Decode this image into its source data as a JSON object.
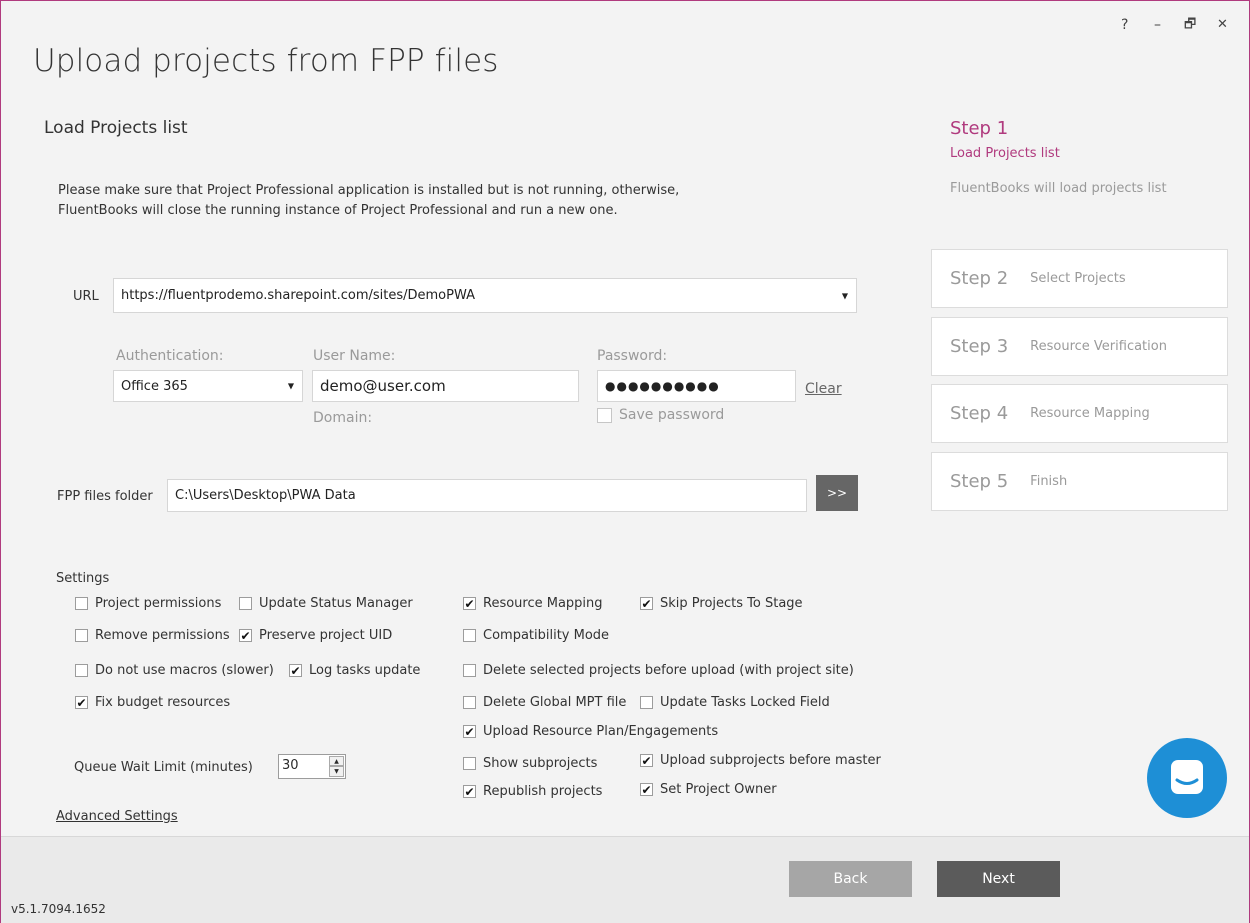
{
  "window": {
    "controls": {
      "help": "?",
      "minimize": "–",
      "restore": "🗗",
      "close": "✕"
    }
  },
  "header": {
    "title": "Upload projects from FPP files"
  },
  "section": {
    "title": "Load Projects list",
    "note_line1": "Please make sure that Project Professional application is installed but is not running, otherwise,",
    "note_line2": "FluentBooks will close the running instance of Project Professional and run a new one."
  },
  "connection": {
    "url_label": "URL",
    "url_value": "https://fluentprodemo.sharepoint.com/sites/DemoPWA",
    "auth_label": "Authentication:",
    "auth_value": "Office 365",
    "username_label": "User Name:",
    "username_value": "demo@user.com",
    "domain_label": "Domain:",
    "password_label": "Password:",
    "password_value": "●●●●●●●●●●",
    "clear_label": "Clear",
    "save_password_label": "Save password",
    "save_password_checked": false
  },
  "folder": {
    "label": "FPP files folder",
    "value": "C:\\Users\\Desktop\\PWA Data",
    "browse_label": ">>"
  },
  "settings": {
    "title": "Settings",
    "items": [
      {
        "label": "Project permissions",
        "checked": false
      },
      {
        "label": "Update Status Manager",
        "checked": false
      },
      {
        "label": "Resource Mapping",
        "checked": true
      },
      {
        "label": "Skip Projects To Stage",
        "checked": true
      },
      {
        "label": "Remove permissions",
        "checked": false
      },
      {
        "label": "Preserve project UID",
        "checked": true
      },
      {
        "label": "Compatibility Mode",
        "checked": false
      },
      {
        "label": "Do not use macros (slower)",
        "checked": false
      },
      {
        "label": "Log tasks update",
        "checked": true
      },
      {
        "label": "Delete selected projects before upload (with project site)",
        "checked": false
      },
      {
        "label": "Fix budget resources",
        "checked": true
      },
      {
        "label": "Delete Global MPT file",
        "checked": false
      },
      {
        "label": "Update Tasks Locked Field",
        "checked": false
      },
      {
        "label": "Upload Resource Plan/Engagements",
        "checked": true
      },
      {
        "label": "Show subprojects",
        "checked": false
      },
      {
        "label": "Upload subprojects before master",
        "checked": true
      },
      {
        "label": "Republish projects",
        "checked": true
      },
      {
        "label": "Set Project Owner",
        "checked": true
      }
    ],
    "queue_label": "Queue Wait Limit (minutes)",
    "queue_value": "30",
    "advanced_label": "Advanced Settings"
  },
  "steps": {
    "current": {
      "num": "Step 1",
      "name": "Load Projects list",
      "desc": "FluentBooks will load projects list"
    },
    "others": [
      {
        "num": "Step 2",
        "name": "Select Projects"
      },
      {
        "num": "Step 3",
        "name": "Resource Verification"
      },
      {
        "num": "Step 4",
        "name": "Resource Mapping"
      },
      {
        "num": "Step 5",
        "name": "Finish"
      }
    ]
  },
  "footer": {
    "back_label": "Back",
    "next_label": "Next",
    "version": "v5.1.7094.1652"
  },
  "colors": {
    "accent": "#b03a7e",
    "chat": "#1e8fd6",
    "next_btn": "#5b5b5b",
    "back_btn": "#a6a6a6",
    "browse_btn": "#666666"
  }
}
